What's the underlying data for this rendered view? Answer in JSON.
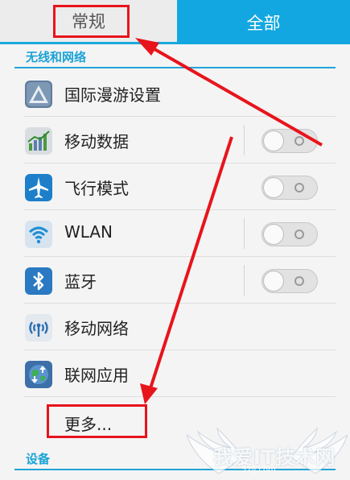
{
  "tabs": {
    "general": "常规",
    "all": "全部"
  },
  "sections": {
    "wireless": "无线和网络",
    "device": "设备"
  },
  "rows": [
    {
      "label": "国际漫游设置",
      "icon": "roaming-triangle-icon",
      "toggle": false
    },
    {
      "label": "移动数据",
      "icon": "mobile-data-chart-icon",
      "toggle": true,
      "on": false
    },
    {
      "label": "飞行模式",
      "icon": "airplane-icon",
      "toggle": true,
      "on": false
    },
    {
      "label": "WLAN",
      "icon": "wifi-icon",
      "toggle": true,
      "on": false
    },
    {
      "label": "蓝牙",
      "icon": "bluetooth-icon",
      "toggle": true,
      "on": false
    },
    {
      "label": "移动网络",
      "icon": "mobile-network-signal-icon",
      "toggle": false
    },
    {
      "label": "联网应用",
      "icon": "network-apps-globe-icon",
      "toggle": false
    }
  ],
  "more": "更多...",
  "watermark": {
    "text": "我爱IT技术网",
    "url": "52ij.com"
  },
  "colors": {
    "accent": "#12a7e0",
    "annotation": "#e8141c"
  }
}
